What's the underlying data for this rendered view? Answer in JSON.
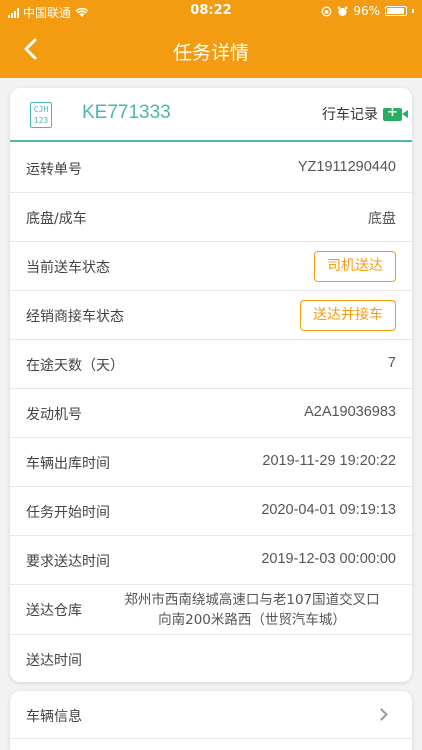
{
  "status_bar": {
    "carrier": "中国联通",
    "time": "08:22",
    "battery": "96%"
  },
  "nav": {
    "title": "任务详情",
    "back_icon": "chevron-left-icon"
  },
  "header": {
    "plate_icon_text": "CJH 123",
    "plate_number": "KE771333",
    "log_label": "行车记录",
    "log_icon": "video-camera-icon"
  },
  "rows": [
    {
      "label": "运转单号",
      "value": "YZ1911290440"
    },
    {
      "label": "底盘/成车",
      "value": "底盘"
    },
    {
      "label": "当前送车状态",
      "tag": "司机送达"
    },
    {
      "label": "经销商接车状态",
      "tag": "送达并接车"
    },
    {
      "label": "在途天数（天）",
      "value": "7"
    },
    {
      "label": "发动机号",
      "value": "A2A19036983"
    },
    {
      "label": "车辆出库时间",
      "value": "2019-11-29 19:20:22"
    },
    {
      "label": "任务开始时间",
      "value": "2020-04-01 09:19:13"
    },
    {
      "label": "要求送达时间",
      "value": "2019-12-03 00:00:00"
    },
    {
      "label": "送达仓库",
      "value_line1": "郑州市西南绕城高速口与老107国道交叉口",
      "value_line2": "向南200米路西（世贸汽车城）"
    },
    {
      "label": "送达时间",
      "value": ""
    }
  ],
  "vehicle_info": {
    "label": "车辆信息"
  },
  "colors": {
    "brand": "#f39c12",
    "accent": "#4db6ac",
    "record_icon": "#27ae60"
  }
}
